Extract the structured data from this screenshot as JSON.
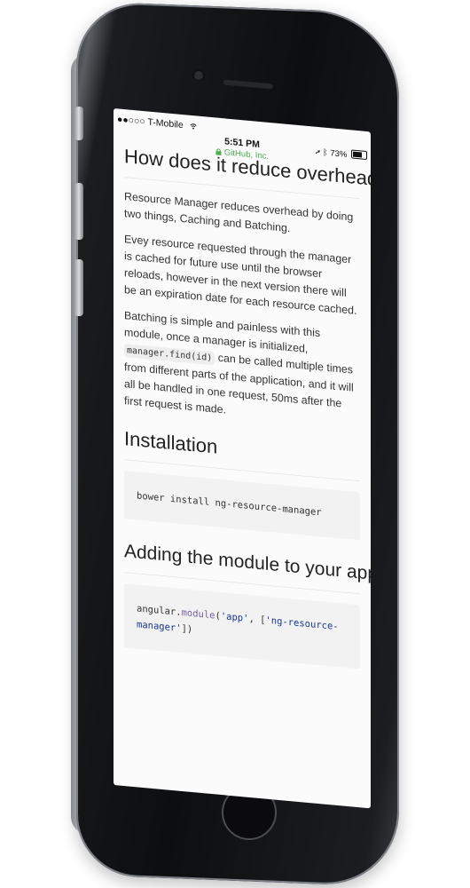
{
  "status_bar": {
    "carrier": "T-Mobile",
    "signal": "●●○○○",
    "time": "5:51 PM",
    "site": "GitHub, Inc.",
    "battery": "73%",
    "battery_level": 0.73
  },
  "article": {
    "heading_overhead": "How does it reduce overhead?",
    "para_intro": "Resource Manager reduces overhead by doing two things, Caching and Batching.",
    "para_caching": "Evey resource requested through the manager is cached for future use until the browser reloads, however in the next version there will be an expiration date for each resource cached.",
    "para_batching_before": "Batching is simple and painless with this module, once a manager is initialized, ",
    "para_batching_code": "manager.find(id)",
    "para_batching_after": " can be called multiple times from different parts of the application, and it will all be handled in one request, 50ms after the first request is made.",
    "heading_installation": "Installation",
    "install_command": "bower install ng-resource-manager",
    "heading_adding": "Adding the module to your app",
    "code_obj": "angular.",
    "code_fn": "module",
    "code_open": "(",
    "code_app": "'app'",
    "code_sep": ", [",
    "code_mod": "'ng-resource-manager'",
    "code_close": "])"
  }
}
